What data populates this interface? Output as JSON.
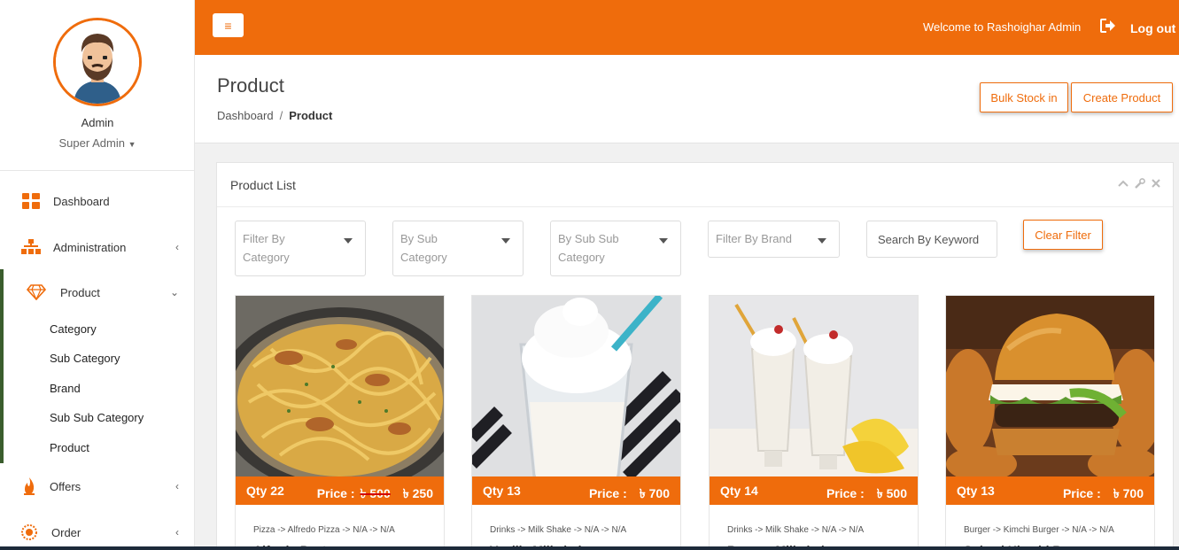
{
  "profile": {
    "name": "Admin",
    "role": "Super Admin"
  },
  "sidebar": {
    "items": [
      {
        "label": "Dashboard",
        "icon": "dashboard-grid-icon"
      },
      {
        "label": "Administration",
        "icon": "sitemap-icon"
      },
      {
        "label": "Product",
        "icon": "diamond-icon"
      },
      {
        "label": "Offers",
        "icon": "flame-icon"
      },
      {
        "label": "Order",
        "icon": "order-icon"
      }
    ],
    "product_subitems": [
      "Category",
      "Sub Category",
      "Brand",
      "Sub Sub Category",
      "Product"
    ]
  },
  "topbar": {
    "menu_icon": "≡",
    "welcome": "Welcome to Rashoighar Admin",
    "logout": "Log out"
  },
  "page": {
    "title": "Product",
    "breadcrumb": [
      "Dashboard",
      "/",
      "Product"
    ],
    "buttons": {
      "bulk_stock": "Bulk Stock in",
      "create_product": "Create Product"
    }
  },
  "card": {
    "title": "Product List",
    "filters": {
      "category_line1": "Filter By",
      "category_line2": "Category",
      "sub_line1": "By Sub",
      "sub_line2": "Category",
      "subsub_line1": "By Sub Sub",
      "subsub_line2": "Category",
      "brand": "Filter By Brand",
      "search_placeholder": "Search By Keyword",
      "clear": "Clear Filter"
    }
  },
  "products": [
    {
      "qty": "Qty 22",
      "price_label": "Price :",
      "old_price": "৳ 500",
      "price": "৳ 250",
      "path": "Pizza -> Alfredo Pizza -> N/A -> N/A",
      "name": "Alfredo Pasta"
    },
    {
      "qty": "Qty 13",
      "price_label": "Price :",
      "old_price": "",
      "price": "৳ 700",
      "path": "Drinks -> Milk Shake -> N/A -> N/A",
      "name": "Vanilla Milkshake"
    },
    {
      "qty": "Qty 14",
      "price_label": "Price :",
      "old_price": "",
      "price": "৳ 500",
      "path": "Drinks -> Milk Shake -> N/A -> N/A",
      "name": "Banana Milkshake"
    },
    {
      "qty": "Qty 13",
      "price_label": "Price :",
      "old_price": "",
      "price": "৳ 700",
      "path": "Burger -> Kimchi Burger -> N/A -> N/A",
      "name": "Spiced Kimchi Burger"
    }
  ],
  "colors": {
    "accent": "#ef6c0c",
    "active_bar": "#3a5d2d"
  }
}
